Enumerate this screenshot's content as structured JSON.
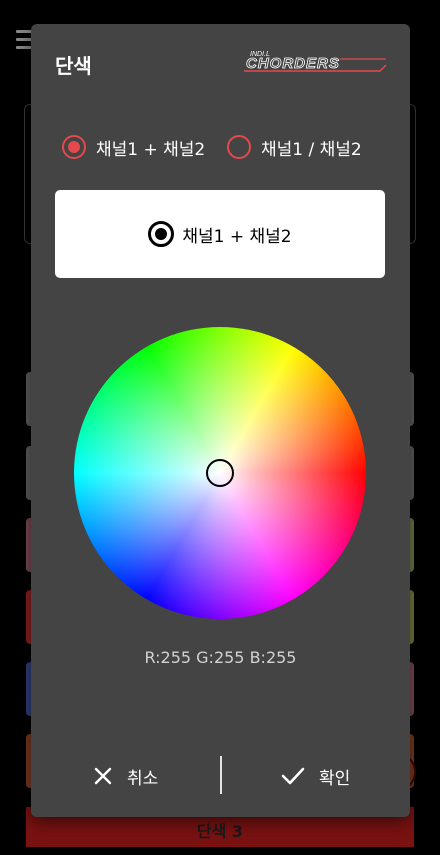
{
  "background": {
    "bottom_bar_label": "단색 3",
    "tile_colors": [
      "#6b6b6b",
      "#6b6b6b",
      "#8a5560",
      "#b12a2a",
      "#2f3f7a",
      "#8a4a2a",
      "#6b6b6b",
      "#6b6b6b",
      "#6d7a4a",
      "#7a7a3a",
      "#8a5560",
      "#7a4a2a"
    ]
  },
  "dialog": {
    "title": "단색",
    "brand_small": "INDI.L",
    "brand_main": "CHORDERS",
    "channel_options": [
      {
        "label": "채널1 + 채널2",
        "selected": true
      },
      {
        "label": "채널1 / 채널2",
        "selected": false
      }
    ],
    "mode_label": "채널1 + 채널2",
    "rgb_text": "R:255 G:255 B:255",
    "cancel_label": "취소",
    "confirm_label": "확인"
  },
  "colors": {
    "accent": "#e5484d",
    "dialog_bg": "#444444",
    "selected_color": "#ffffff"
  },
  "icons": {
    "cancel": "close-icon",
    "confirm": "check-icon",
    "menu": "menu-icon"
  }
}
